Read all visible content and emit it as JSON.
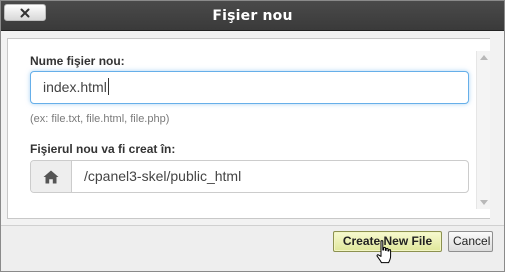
{
  "dialog": {
    "title": "Fişier nou",
    "close_icon": "close-x-icon"
  },
  "form": {
    "name_label": "Nume fişier nou:",
    "name_value": "index.html",
    "name_hint": "(ex: file.txt, file.html, file.php)",
    "path_label": "Fişierul nou va fi creat în:",
    "path_icon": "home-icon",
    "path_value": "/cpanel3-skel/public_html"
  },
  "footer": {
    "create_label": "Create New File",
    "cancel_label": "Cancel"
  }
}
